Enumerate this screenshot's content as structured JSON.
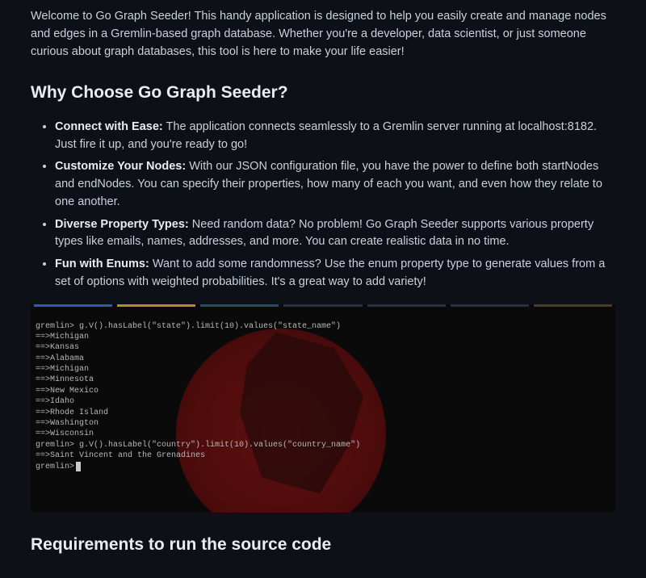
{
  "intro": "Welcome to Go Graph Seeder! This handy application is designed to help you easily create and manage nodes and edges in a Gremlin-based graph database. Whether you're a developer, data scientist, or just someone curious about graph databases, this tool is here to make your life easier!",
  "why_heading": "Why Choose Go Graph Seeder?",
  "features": [
    {
      "title": "Connect with Ease:",
      "text": " The application connects seamlessly to a Gremlin server running at localhost:8182. Just fire it up, and you're ready to go!"
    },
    {
      "title": "Customize Your Nodes:",
      "text": " With our JSON configuration file, you have the power to define both startNodes and endNodes. You can specify their properties, how many of each you want, and even how they relate to one another."
    },
    {
      "title": "Diverse Property Types:",
      "text": " Need random data? No problem! Go Graph Seeder supports various property types like emails, names, addresses, and more. You can create realistic data in no time."
    },
    {
      "title": "Fun with Enums:",
      "text": " Want to add some randomness? Use the enum property type to generate values from a set of options with weighted probabilities. It's a great way to add variety!"
    }
  ],
  "terminal": {
    "lines": [
      "gremlin> g.V().hasLabel(\"state\").limit(10).values(\"state_name\")",
      "==>Michigan",
      "==>Kansas",
      "==>Alabama",
      "==>Michigan",
      "==>Minnesota",
      "==>New Mexico",
      "==>Idaho",
      "==>Rhode Island",
      "==>Washington",
      "==>Wisconsin",
      "gremlin> g.V().hasLabel(\"country\").limit(10).values(\"country_name\")",
      "==>Saint Vincent and the Grenadines",
      "gremlin>"
    ]
  },
  "req_heading": "Requirements to run the source code"
}
